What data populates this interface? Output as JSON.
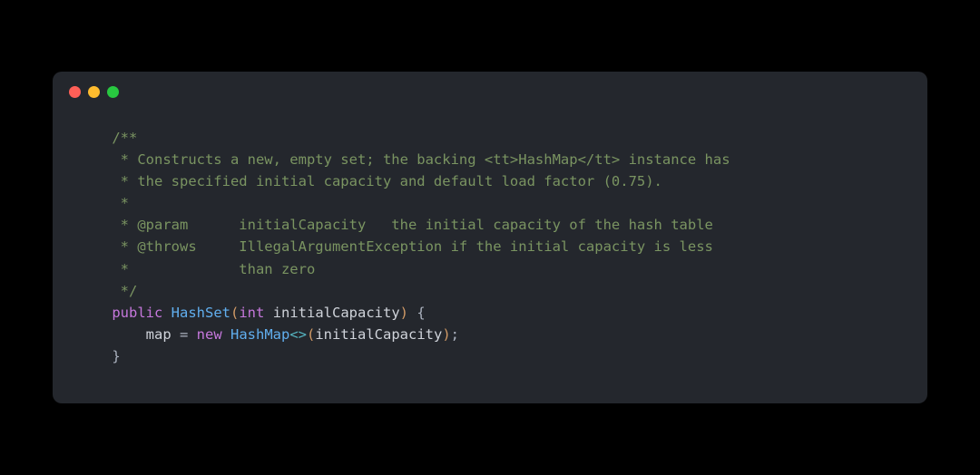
{
  "window": {
    "dots": [
      "red",
      "yellow",
      "green"
    ]
  },
  "code": {
    "comment1": "    /**",
    "comment2": "     * Constructs a new, empty set; the backing <tt>HashMap</tt> instance has",
    "comment3": "     * the specified initial capacity and default load factor (0.75).",
    "comment4": "     *",
    "comment5": "     * @param      initialCapacity   the initial capacity of the hash table",
    "comment6": "     * @throws     IllegalArgumentException if the initial capacity is less",
    "comment7": "     *             than zero",
    "comment8": "     */",
    "kw_public": "public",
    "type_hashset": "HashSet",
    "kw_int": "int",
    "param_name": "initialCapacity",
    "ident_map": "map",
    "kw_new": "new",
    "type_hashmap": "HashMap",
    "generics": "<>",
    "param_ref": "initialCapacity",
    "indent1": "    ",
    "indent2": "        ",
    "lparen": "(",
    "rparen": ")",
    "lbrace": " {",
    "rbrace": "}",
    "space": " ",
    "eq": " = ",
    "semi": ";"
  }
}
